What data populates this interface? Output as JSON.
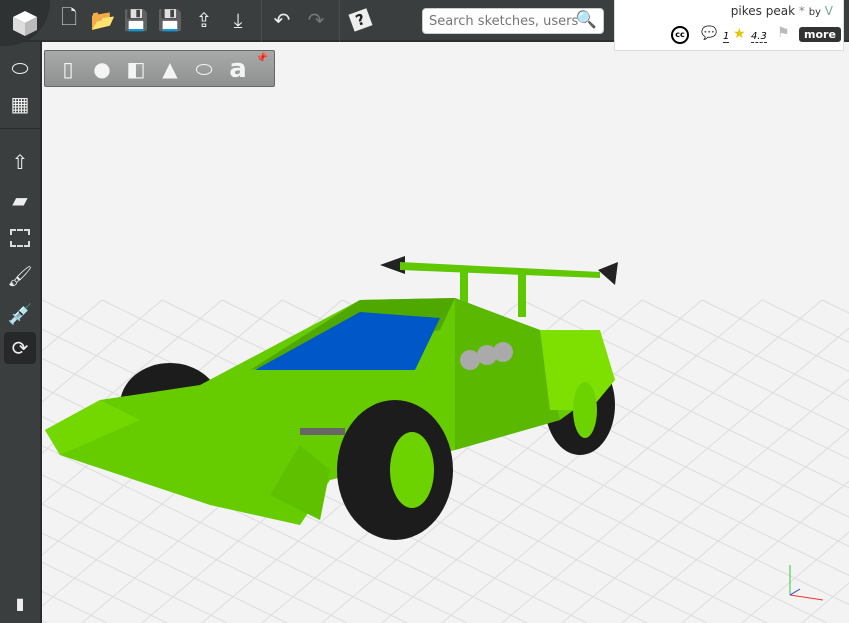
{
  "toolbar": {
    "buttons": [
      "new",
      "open",
      "save",
      "save-as",
      "upload",
      "download",
      "undo",
      "redo",
      "help"
    ]
  },
  "search": {
    "placeholder": "Search sketches, users.."
  },
  "sketch": {
    "title": "pikes peak",
    "modified": "*",
    "by_label": "by",
    "author": "V",
    "comments": "1",
    "rating": "4.3",
    "more_label": "more",
    "license": "cc"
  },
  "shapes": [
    "cylinder",
    "sphere",
    "box",
    "cone",
    "torus",
    "text"
  ],
  "text_shape_glyph": "a",
  "colors": {
    "bar": "#3b3e3f",
    "car": "#66cc00",
    "windshield": "#0055cc"
  }
}
